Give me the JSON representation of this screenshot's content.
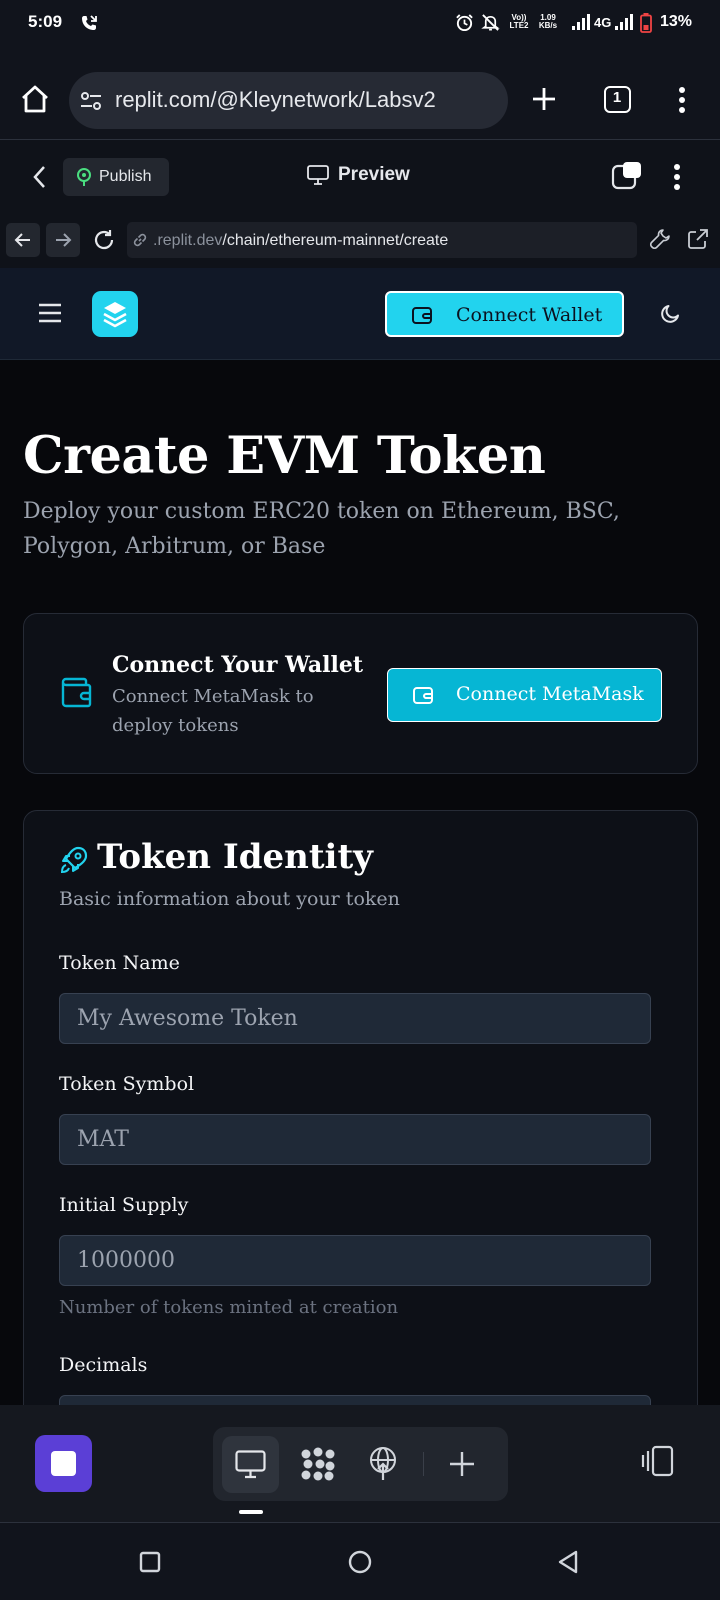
{
  "status_bar": {
    "time": "5:09",
    "net_volte": "Vo)) LTE2",
    "net_speed": "1.09 KB/s",
    "network_type": "4G",
    "battery_percent": "13%"
  },
  "browser": {
    "url": "replit.com/@Kleynetwork/Labsv2",
    "tab_count": "1"
  },
  "replit_header": {
    "publish_label": "Publish",
    "preview_label": "Preview"
  },
  "devtools": {
    "url_domain": ".replit.dev",
    "url_path": "/chain/ethereum-mainnet/create"
  },
  "site_nav": {
    "connect_wallet_label": "Connect Wallet"
  },
  "page": {
    "title": "Create EVM Token",
    "subtitle": "Deploy your custom ERC20 token on Ethereum, BSC, Polygon, Arbitrum, or Base"
  },
  "wallet_card": {
    "title": "Connect Your Wallet",
    "description": "Connect MetaMask to deploy tokens",
    "button_label": "Connect MetaMask"
  },
  "identity_card": {
    "title": "Token Identity",
    "description": "Basic information about your token",
    "fields": {
      "name": {
        "label": "Token Name",
        "placeholder": "My Awesome Token"
      },
      "symbol": {
        "label": "Token Symbol",
        "placeholder": "MAT"
      },
      "supply": {
        "label": "Initial Supply",
        "placeholder": "1000000",
        "help": "Number of tokens minted at creation"
      },
      "decimals": {
        "label": "Decimals"
      }
    }
  },
  "colors": {
    "accent": "#22d3ee",
    "accent_dark": "#06b6d4",
    "run_button": "#5b3fd6",
    "background": "#07080c"
  }
}
